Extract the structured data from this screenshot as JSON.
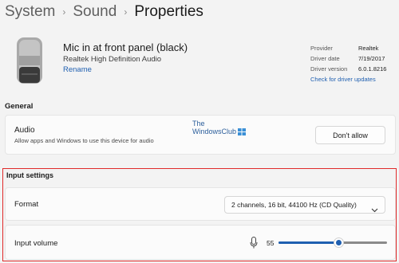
{
  "breadcrumb": {
    "items": [
      "System",
      "Sound",
      "Properties"
    ],
    "separator": "›"
  },
  "device": {
    "name": "Mic in at front panel (black)",
    "subtitle": "Realtek High Definition Audio",
    "rename_label": "Rename",
    "icon": "microphone-device-icon"
  },
  "driver": {
    "provider_key": "Provider",
    "provider_val": "Realtek",
    "date_key": "Driver date",
    "date_val": "7/19/2017",
    "version_key": "Driver version",
    "version_val": "6.0.1.8216",
    "update_link": "Check for driver updates"
  },
  "general": {
    "title": "General",
    "audio_title": "Audio",
    "audio_desc": "Allow apps and Windows to use this device for audio",
    "dont_allow_label": "Don't allow"
  },
  "watermark": {
    "line1": "The",
    "line2": "WindowsClub"
  },
  "input_settings": {
    "title": "Input settings",
    "format_label": "Format",
    "format_value": "2 channels, 16 bit, 44100 Hz (CD Quality)",
    "volume_label": "Input volume",
    "volume_value": "55",
    "volume_level": 0.55
  },
  "colors": {
    "accent": "#1f5fb0",
    "highlight": "#e02a2a",
    "background": "#f3f3f3",
    "card": "#fbfbfb"
  }
}
